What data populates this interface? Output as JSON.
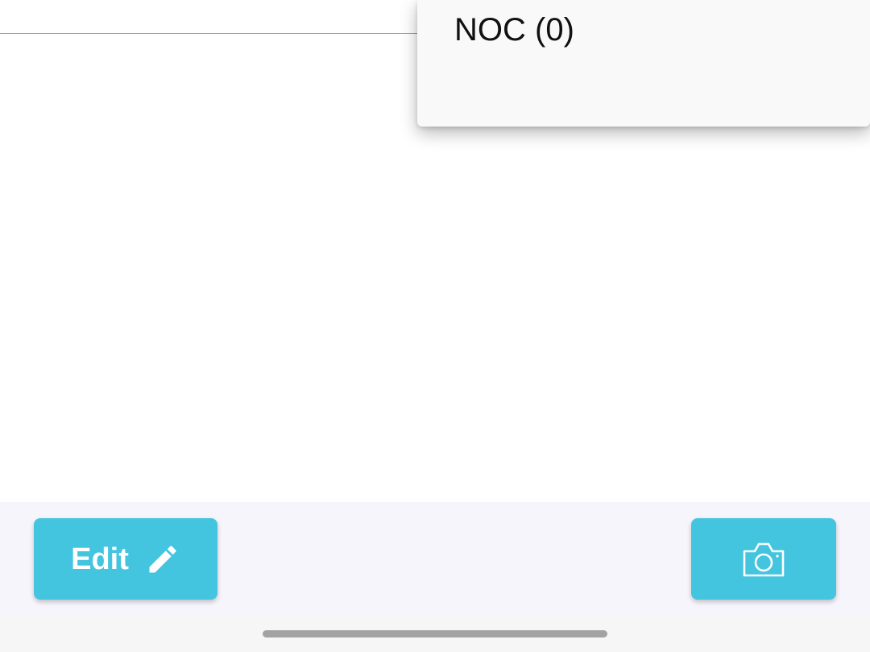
{
  "menu": {
    "items": [
      {
        "label": "NOC (0)"
      }
    ]
  },
  "actions": {
    "edit_label": "Edit",
    "edit_icon": "pencil-icon",
    "camera_icon": "camera-icon"
  },
  "colors": {
    "accent": "#43c4df",
    "menu_background": "#f9f9f9",
    "bottom_bar_background": "#f6f5fb"
  }
}
